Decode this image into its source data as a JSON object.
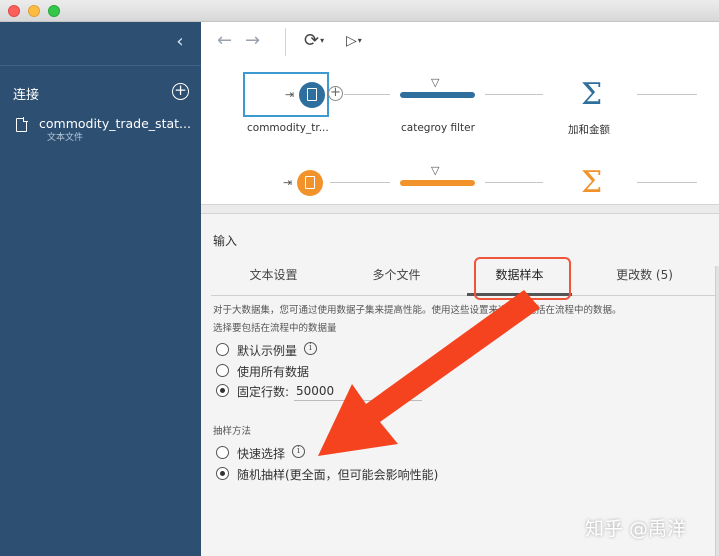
{
  "window": {
    "traffic_lights": [
      "close",
      "minimize",
      "zoom"
    ]
  },
  "sidebar": {
    "collapse_icon": "chevron-left-icon",
    "connections_title": "连接",
    "add_icon": "plus-circle-icon",
    "items": [
      {
        "name": "commodity_trade_stat...",
        "type": "文本文件",
        "icon": "document-icon"
      }
    ],
    "background": "#2d4f71"
  },
  "toolbar": {
    "back_icon": "←",
    "forward_icon": "→",
    "refresh_icon": "⟳",
    "run_icon": "▷",
    "caret": "▾"
  },
  "flow": {
    "row1": {
      "input_label": "commodity_tr...",
      "filter_label": "categroy filter",
      "aggregate_label": "加和金额",
      "color": "#2e6f9e"
    },
    "row2": {
      "color": "#f2922a"
    },
    "filter_icon": "▽",
    "sigma": "Σ",
    "plus": "+",
    "input_arrow": "⇥"
  },
  "panel": {
    "title": "输入",
    "tabs": [
      {
        "label": "文本设置",
        "active": false
      },
      {
        "label": "多个文件",
        "active": false
      },
      {
        "label": "数据样本",
        "active": true
      },
      {
        "label": "更改数 (5)",
        "active": false
      }
    ],
    "hint": "对于大数据集，您可通过使用数据子集来提高性能。使用这些设置来选择要包括在流程中的数据。",
    "sample_section": {
      "label": "选择要包括在流程中的数据量",
      "options": [
        {
          "label": "默认示例量",
          "checked": false,
          "info": true
        },
        {
          "label": "使用所有数据",
          "checked": false,
          "info": false
        },
        {
          "label": "固定行数:",
          "checked": true,
          "info": false
        }
      ],
      "rows_value": "50000"
    },
    "method_section": {
      "label": "抽样方法",
      "options": [
        {
          "label": "快速选择",
          "checked": false,
          "info": true
        },
        {
          "label": "随机抽样(更全面，但可能会影响性能)",
          "checked": true,
          "info": false
        }
      ]
    },
    "info_glyph": "i"
  },
  "annotation": {
    "highlight_color": "#f0553a",
    "arrow_color": "#f5421f"
  },
  "watermark": "知乎 @禹洋"
}
